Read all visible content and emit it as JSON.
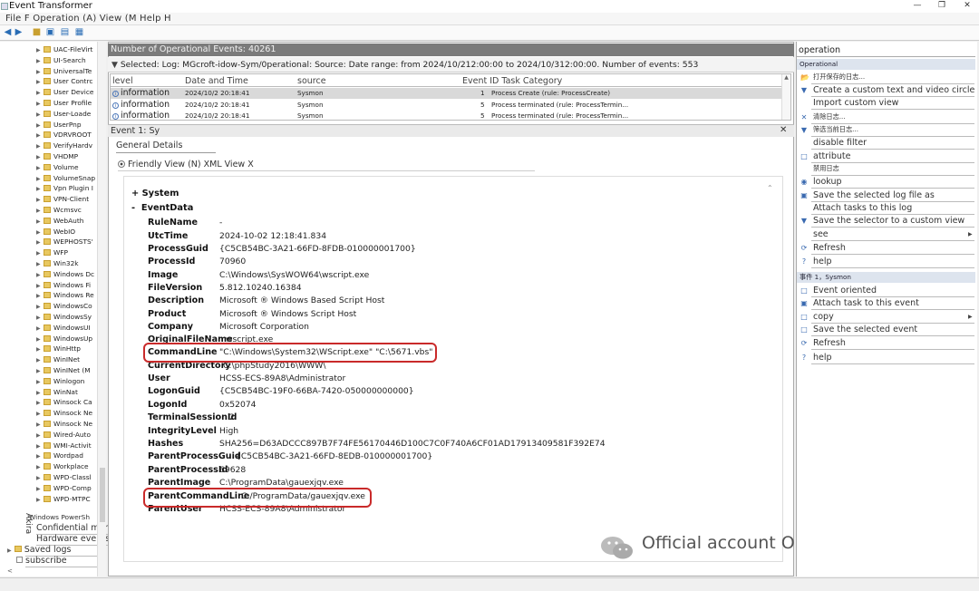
{
  "window": {
    "title": "Event Transformer",
    "menu": "File F Operation (A) View (M Help H"
  },
  "tree": {
    "items": [
      "UAC-FileVirt",
      "UI-Search",
      "UniversalTe",
      "User Contrc",
      "User Device",
      "User Profile",
      "User-Loade",
      "UserPnp",
      "VDRVROOT",
      "VerifyHardv",
      "VHDMP",
      "Volume",
      "VolumeSnap",
      "Vpn Plugin I",
      "VPN-Client",
      "Wcmsvc",
      "WebAuth",
      "WebIO",
      "WEPHOSTS'",
      "WFP",
      "Win32k",
      "Windows Dc",
      "Windows Fi",
      "Windows Re",
      "WindowsCo",
      "WindowsSy",
      "WindowsUI",
      "WindowsUp",
      "WinHttp",
      "WinINet",
      "WinINet (M",
      "Winlogon",
      "WinNat",
      "Winsock Ca",
      "Winsock Ne",
      "Winsock Ne",
      "Wired-Auto",
      "WMI-Activit",
      "Wordpad",
      "Workplace",
      "WPD-Classl",
      "WPD-Comp",
      "WPD-MTPC"
    ],
    "powershell": "Windows PowerSh",
    "akira": "Akira",
    "confidential": "Confidential management service",
    "hardware": "Hardware events",
    "saved_logs": "Saved logs",
    "subscribe": "subscribe"
  },
  "center": {
    "count_label": "Number of Operational Events: 40261",
    "filter_text": "Selected: Log: MGcroft-idow-Sym/0perational: Source: Date range: from 2024/10/212:00:00 to 2024/10/312:00:00. Number of events: 553",
    "columns": {
      "level": "level",
      "datetime": "Date and Time",
      "source": "source",
      "eventid": "Event ID Task Category"
    },
    "rows": [
      {
        "level": "information",
        "datetime": "2024/10/2 20:18:41",
        "source": "Sysmon",
        "id": "1",
        "task": "Process Create (rule: ProcessCreate)"
      },
      {
        "level": "information",
        "datetime": "2024/10/2 20:18:41",
        "source": "Sysmon",
        "id": "5",
        "task": "Process terminated (rule: ProcessTermin..."
      },
      {
        "level": "information",
        "datetime": "2024/10/2 20:18:41",
        "source": "Sysmon",
        "id": "5",
        "task": "Process terminated (rule: ProcessTermin..."
      }
    ],
    "event_header": "Event 1: Sy",
    "tab_general": "General Details",
    "view_toggle": "Friendly View (N) XML View X",
    "system_label": "System",
    "eventdata_label": "EventData",
    "fields": [
      {
        "k": "RuleName",
        "v": "-"
      },
      {
        "k": "UtcTime",
        "v": "2024-10-02 12:18:41.834"
      },
      {
        "k": "ProcessGuid",
        "v": "{C5CB54BC-3A21-66FD-8FDB-010000001700}"
      },
      {
        "k": "ProcessId",
        "v": "70960"
      },
      {
        "k": "Image",
        "v": "C:\\Windows\\SysWOW64\\wscript.exe"
      },
      {
        "k": "FileVersion",
        "v": "5.812.10240.16384"
      },
      {
        "k": "Description",
        "v": "Microsoft ® Windows Based Script Host"
      },
      {
        "k": "Product",
        "v": "Microsoft ® Windows Script Host"
      },
      {
        "k": "Company",
        "v": "Microsoft Corporation"
      },
      {
        "k": "OriginalFileName",
        "v": "wscript.exe"
      },
      {
        "k": "CommandLine",
        "v": "\"C:\\Windows\\System32\\WScript.exe\" \"C:\\5671.vbs\""
      },
      {
        "k": "CurrentDirectory",
        "v": "C:\\phpStudy2016\\WWW\\"
      },
      {
        "k": "User",
        "v": "HCSS-ECS-89A8\\Administrator"
      },
      {
        "k": "LogonGuid",
        "v": "{C5CB54BC-19F0-66BA-7420-050000000000}"
      },
      {
        "k": "LogonId",
        "v": "0x52074"
      },
      {
        "k": "TerminalSessionId",
        "v": "2"
      },
      {
        "k": "IntegrityLevel",
        "v": "High"
      },
      {
        "k": "Hashes",
        "v": "SHA256=D63ADCCC897B7F74FE56170446D100C7C0F740A6CF01AD17913409581F392E74"
      },
      {
        "k": "ParentProcessGuid",
        "v": "{C5CB54BC-3A21-66FD-8EDB-010000001700}"
      },
      {
        "k": "ParentProcessId",
        "v": "69628"
      },
      {
        "k": "ParentImage",
        "v": "C:\\ProgramData\\gauexjqv.exe"
      },
      {
        "k": "ParentCommandLine",
        "v": "C:/ProgramData/gauexjqv.exe"
      },
      {
        "k": "ParentUser",
        "v": "HCSS-ECS-89A8\\Administrator"
      }
    ],
    "watermark": "Official account OneMoreThink"
  },
  "actions": {
    "title": "operation",
    "section1": "Operational",
    "items1": [
      "打开保存的日志...",
      "Create a custom text and video circle",
      "Import custom view",
      "清除日志...",
      "筛选当前日志...",
      "disable filter",
      "attribute",
      "禁用日志",
      "lookup",
      "Save the selected log file as",
      "Attach tasks to this log",
      "Save the selector to a custom view",
      "see",
      "Refresh",
      "help"
    ],
    "section2": "事件 1，Sysmon",
    "items2": [
      "Event oriented",
      "Attach task to this event",
      "copy",
      "Save the selected event",
      "Refresh",
      "help"
    ]
  },
  "colors": {
    "highlight": "#c92a2a",
    "count_bar": "#7b7b7b",
    "action_header": "#dde4ee"
  }
}
